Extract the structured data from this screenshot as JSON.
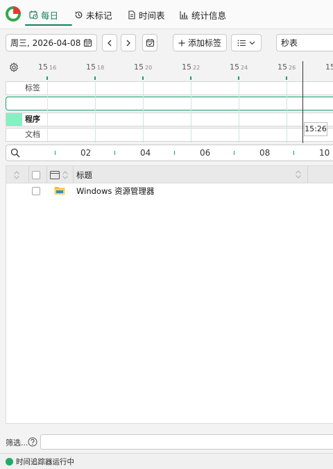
{
  "nav": {
    "tabs": [
      {
        "label": "每日",
        "icon": "calendar-clock-icon",
        "active": true
      },
      {
        "label": "未标记",
        "icon": "history-icon"
      },
      {
        "label": "时间表",
        "icon": "document-icon"
      },
      {
        "label": "统计信息",
        "icon": "bar-chart-icon"
      }
    ]
  },
  "toolbar": {
    "date": "周三, 2026-04-08",
    "add_tag_label": "添加标签",
    "stopwatch_value": "秒表"
  },
  "timeline": {
    "tick_labels": [
      {
        "hour": "15",
        "minute": "16"
      },
      {
        "hour": "15",
        "minute": "18"
      },
      {
        "hour": "15",
        "minute": "20"
      },
      {
        "hour": "15",
        "minute": "22"
      },
      {
        "hour": "15",
        "minute": "24"
      },
      {
        "hour": "15",
        "minute": "26"
      },
      {
        "hour": "15",
        "minute": ""
      }
    ],
    "rows": [
      {
        "label": "标签"
      },
      {
        "label": ""
      },
      {
        "label": "程序"
      },
      {
        "label": "文档"
      }
    ],
    "cursor_time": "15:26"
  },
  "hour_axis": {
    "labels": [
      "02",
      "04",
      "06",
      "08",
      "10"
    ]
  },
  "table": {
    "columns": [
      "标题"
    ],
    "rows": [
      {
        "title": "Windows 资源管理器",
        "icon": "folder-icon"
      }
    ]
  },
  "filter": {
    "label": "筛选...",
    "value": ""
  },
  "status": {
    "text": "时间追踪器运行中"
  },
  "colors": {
    "accent": "#17805a",
    "tick_green": "#17a06b",
    "program_block": "#86f0c2",
    "status_running": "#1faa6a"
  }
}
